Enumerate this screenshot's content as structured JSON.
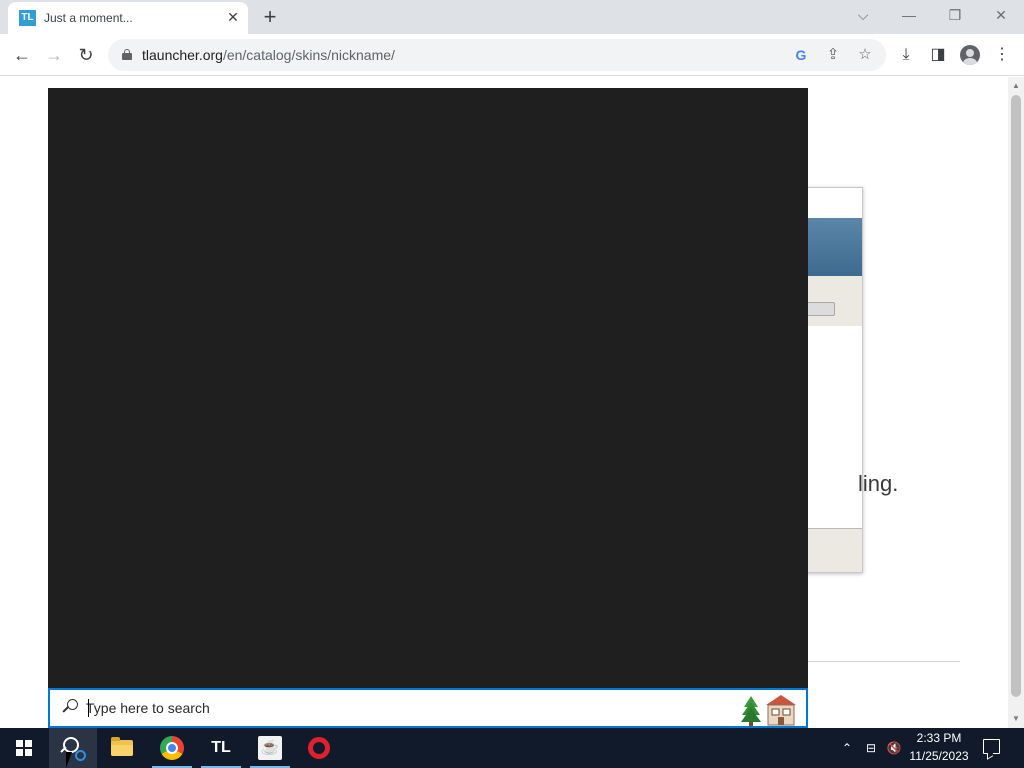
{
  "browser": {
    "tab": {
      "favicon_text": "TL",
      "title": "Just a moment...",
      "close_glyph": "✕"
    },
    "new_tab_glyph": "+",
    "window_controls": {
      "dropdown": "⌵",
      "minimize": "—",
      "restore": "❐",
      "close": "✕"
    },
    "nav": {
      "back": "←",
      "forward": "→",
      "reload": "↻"
    },
    "address": {
      "host": "tlauncher.org",
      "path": "/en/catalog/skins/nickname/"
    },
    "omnibox_icons": {
      "google": "G",
      "share": "⇪",
      "bookmark": "☆"
    },
    "toolbar_icons": {
      "download": "⤓",
      "side_panel": "◨",
      "menu": "⋮"
    }
  },
  "page": {
    "partial_text": "ling."
  },
  "search": {
    "placeholder": "Type here to search"
  },
  "taskbar": {
    "apps": [
      {
        "name": "start"
      },
      {
        "name": "search"
      },
      {
        "name": "file-explorer"
      },
      {
        "name": "chrome"
      },
      {
        "name": "tlauncher",
        "label": "TL"
      },
      {
        "name": "java",
        "glyph": "☕"
      },
      {
        "name": "opera"
      }
    ],
    "tray": {
      "chevron": "⌃",
      "network": "⊟",
      "volume": "🔇"
    },
    "clock": {
      "time": "2:33 PM",
      "date": "11/25/2023"
    }
  },
  "colors": {
    "taskbar_bg": "#101a2b",
    "search_panel_bg": "#1f1f1f",
    "search_border": "#0078d7",
    "tab_strip": "#dee1e6"
  }
}
